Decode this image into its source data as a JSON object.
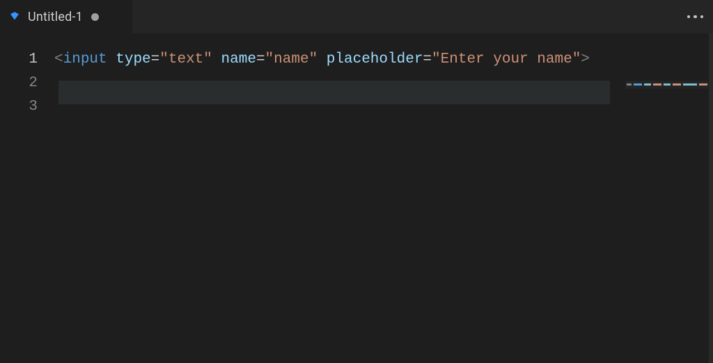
{
  "tab": {
    "filename": "Untitled-1",
    "is_dirty": true
  },
  "editor": {
    "line_numbers": [
      "1",
      "2",
      "3"
    ],
    "active_line": 1,
    "code": {
      "line1": "",
      "line2": "",
      "line3_tokens": {
        "lt": "<",
        "tag": "input",
        "sp": " ",
        "attr_type": "type",
        "eq": "=",
        "q": "\"",
        "val_type": "text",
        "attr_name": "name",
        "val_name": "name",
        "attr_ph": "placeholder",
        "val_ph_a": "Enter your ",
        "val_ph_b": "name",
        "gt": ">"
      }
    }
  }
}
